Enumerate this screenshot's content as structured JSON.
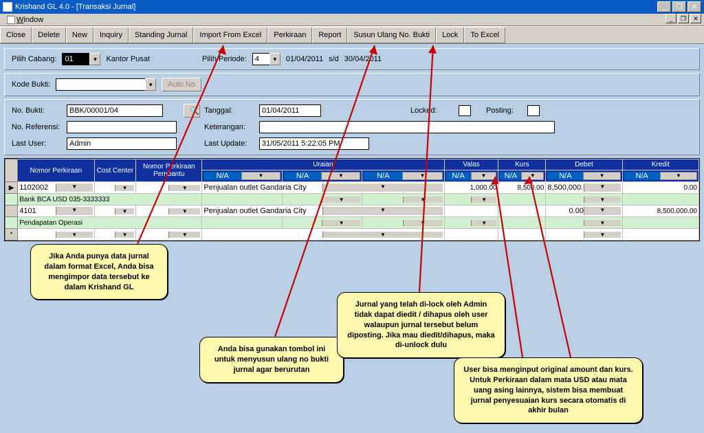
{
  "title": "Krishand GL 4.0 - [Transaksi Jurnal]",
  "menu": {
    "window": "Window"
  },
  "toolbar": [
    "Close",
    "Delete",
    "New",
    "Inquiry",
    "Standing Jurnal",
    "Import From Excel",
    "Perkiraan",
    "Report",
    "Susun Ulang No. Bukti",
    "Lock",
    "To Excel"
  ],
  "filter1": {
    "pilih_cabang_lbl": "Pilih Cabang:",
    "cabang": "01",
    "cabang_name": "Kantor Pusat",
    "pilih_periode_lbl": "Pilih Periode:",
    "periode": "4",
    "date_from": "01/04/2011",
    "sd": "s/d",
    "date_to": "30/04/2011"
  },
  "filter2": {
    "kode_bukti_lbl": "Kode Bukti:",
    "kode_bukti": "",
    "auto_no": "Auto No"
  },
  "form": {
    "no_bukti_lbl": "No. Bukti:",
    "no_bukti": "BBK/00001/04",
    "no_ref_lbl": "No. Referensi:",
    "no_ref": "",
    "last_user_lbl": "Last User:",
    "last_user": "Admin",
    "tanggal_lbl": "Tanggal:",
    "tanggal": "01/04/2011",
    "keterangan_lbl": "Keterangan:",
    "keterangan": "",
    "last_update_lbl": "Last Update:",
    "last_update": "31/05/2011 5:22:05 PM",
    "locked_lbl": "Locked:",
    "posting_lbl": "Posting:"
  },
  "grid": {
    "headers": [
      "Nomor Perkiraan",
      "Cost Center",
      "Nomor Perkiraan Pembantu",
      "Uraian",
      "Valas",
      "Kurs",
      "Debet",
      "Kredit"
    ],
    "na": "N/A",
    "rows": [
      {
        "marker": "▶",
        "perk": "1102002",
        "uraian": "Penjualan outlet Gandaria City",
        "valas": "1,000.00",
        "kurs": "8,500.00",
        "debet": "8,500,000.00",
        "kredit": "0.00",
        "sub": "Bank BCA USD 035-3333333"
      },
      {
        "marker": "",
        "perk": "4101",
        "uraian": "Penjualan outlet Gandaria City",
        "valas": "",
        "kurs": "",
        "debet": "0.00",
        "kredit": "8,500,000.00",
        "sub": "Pendapatan Operasi"
      },
      {
        "marker": "*",
        "perk": "",
        "uraian": "",
        "valas": "",
        "kurs": "",
        "debet": "",
        "kredit": "",
        "sub": null
      }
    ]
  },
  "callouts": {
    "c1": "Jika Anda punya data jurnal dalam format Excel, Anda bisa mengimpor data tersebut ke dalam Krishand GL",
    "c2": "Anda bisa gunakan tombol ini untuk menyusun ulang no bukti jurnal agar berurutan",
    "c3": "Jurnal yang telah di-lock oleh Admin tidak dapat diedit / dihapus oleh user walaupun jurnal tersebut belum diposting. Jika mau diedit/dihapus, maka di-unlock dulu",
    "c4": "User bisa menginput original amount dan kurs. Untuk Perkiraan dalam mata USD atau mata uang asing lainnya, sistem bisa membuat jurnal penyesuaian kurs secara otomatis di akhir bulan"
  }
}
